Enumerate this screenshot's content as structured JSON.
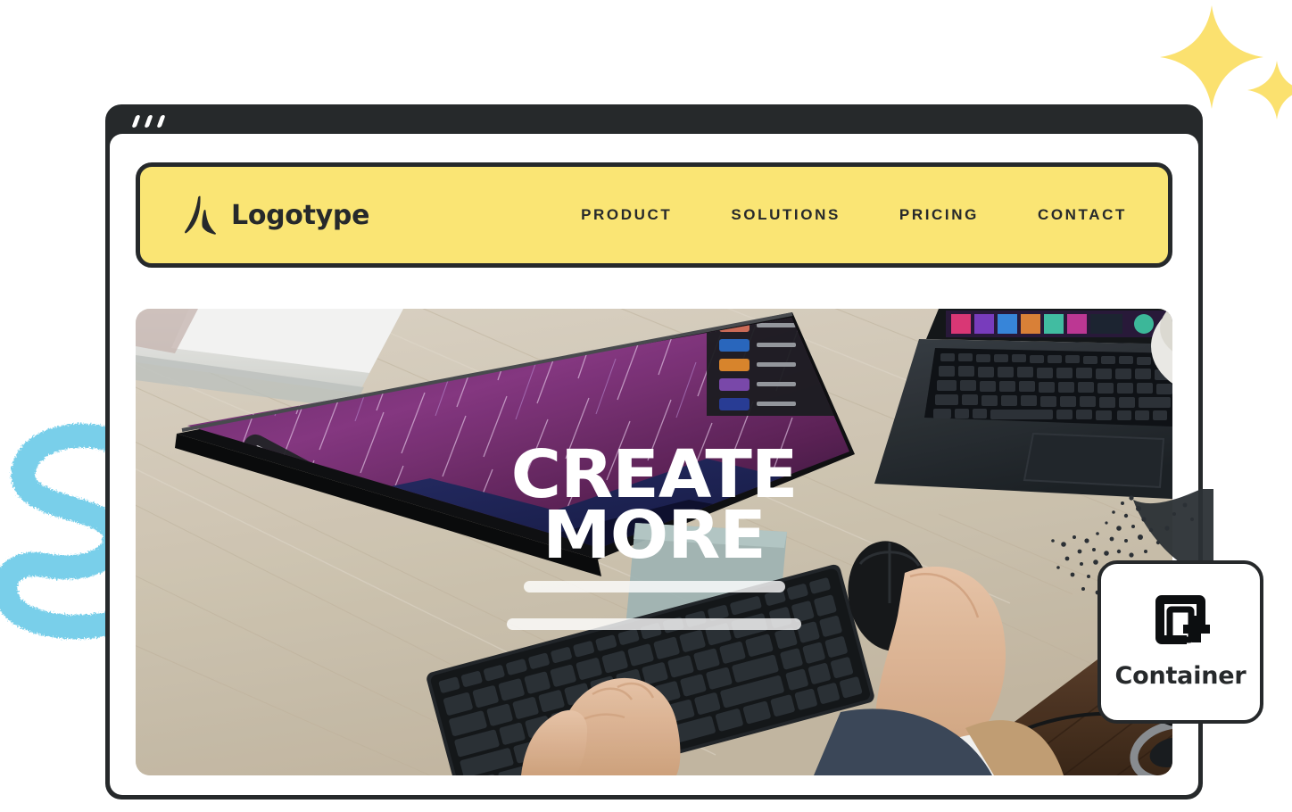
{
  "decor": {
    "sparkle_large": "sparkle-icon",
    "sparkle_small": "sparkle-icon",
    "squiggle": "squiggle-brush-stroke",
    "particles": "particle-dispersion",
    "sparkle_color": "#FBE16F",
    "squiggle_color": "#79CFEA"
  },
  "window": {
    "frame_color": "#26292B",
    "controls": [
      "dash",
      "dash",
      "dash"
    ]
  },
  "navbar": {
    "background": "#FAE574",
    "border_color": "#26292B",
    "brand": {
      "logo_icon": "logotype-a-mark",
      "name": "Logotype"
    },
    "links": [
      {
        "label": "PRODUCT"
      },
      {
        "label": "SOLUTIONS"
      },
      {
        "label": "PRICING"
      },
      {
        "label": "CONTACT"
      }
    ]
  },
  "hero": {
    "headline_line1": "CREATE",
    "headline_line2": "MORE",
    "text_color": "#FFFFFF",
    "placeholder_bars": 2,
    "photo": {
      "description": "overhead desk workspace",
      "desk_color": "#D9CFBC",
      "monitor_wallpaper": "purple star trails",
      "laptop_color": "#2B2F33"
    }
  },
  "container_chip": {
    "icon": "add-container-icon",
    "label": "Container",
    "border_color": "#26292B",
    "background": "#FFFFFF"
  }
}
